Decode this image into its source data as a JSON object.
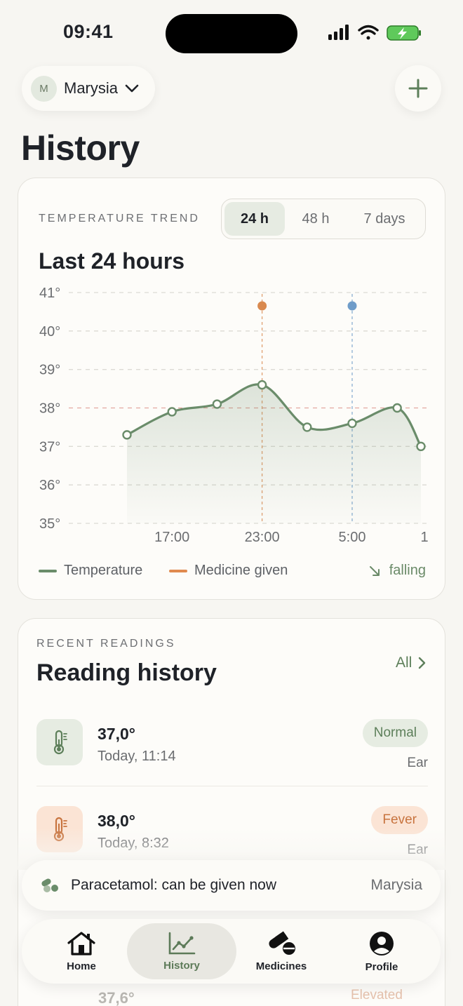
{
  "status_bar": {
    "time": "09:41"
  },
  "header": {
    "profile_initial": "M",
    "profile_name": "Marysia",
    "title": "History"
  },
  "trend": {
    "eyebrow": "TEMPERATURE TREND",
    "ranges": [
      "24 h",
      "48 h",
      "7 days"
    ],
    "selected_range": "24 h",
    "title": "Last 24 hours",
    "legend_temperature": "Temperature",
    "legend_medicine": "Medicine given",
    "trend_label": "falling"
  },
  "chart_data": {
    "type": "line",
    "title": "Last 24 hours",
    "y_ticks": [
      "41°",
      "40°",
      "39°",
      "38°",
      "37°",
      "36°",
      "35°"
    ],
    "ylim": [
      35,
      41
    ],
    "x_ticks": [
      "17:00",
      "23:00",
      "5:00",
      "1"
    ],
    "grid": true,
    "fever_threshold": 38,
    "series": [
      {
        "name": "Temperature",
        "points": [
          {
            "x": "14:00",
            "y": 37.3
          },
          {
            "x": "17:00",
            "y": 37.9
          },
          {
            "x": "20:00",
            "y": 38.1
          },
          {
            "x": "23:00",
            "y": 38.6
          },
          {
            "x": "2:00",
            "y": 37.5
          },
          {
            "x": "5:00",
            "y": 37.6
          },
          {
            "x": "8:00",
            "y": 38.0
          },
          {
            "x": "11:14",
            "y": 37.0
          }
        ]
      }
    ],
    "medicine_events": [
      {
        "x": "23:00",
        "color": "#d9894f"
      },
      {
        "x": "5:00",
        "color": "#6f9cc9"
      }
    ],
    "colors": {
      "line": "#6a8c6a",
      "fever_line": "#e3a7a0"
    }
  },
  "readings": {
    "eyebrow": "RECENT READINGS",
    "title": "Reading history",
    "all_label": "All",
    "items": [
      {
        "value": "37,0°",
        "time": "Today, 11:14",
        "status": "Normal",
        "method": "Ear"
      },
      {
        "value": "38,0°",
        "time": "Today, 8:32",
        "status": "Fever",
        "method": "Ear"
      }
    ],
    "peek_value": "37,6°",
    "peek_status": "Elevated"
  },
  "toast": {
    "text": "Paracetamol: can be given now",
    "who": "Marysia"
  },
  "tabs": [
    {
      "label": "Home",
      "icon": "home-icon"
    },
    {
      "label": "History",
      "icon": "chart-icon"
    },
    {
      "label": "Medicines",
      "icon": "pills-icon"
    },
    {
      "label": "Profile",
      "icon": "profile-icon"
    }
  ],
  "active_tab": "History",
  "colors": {
    "accent": "#5d7f5a",
    "normal_badge_bg": "#e6ece2",
    "fever_badge_bg": "#fbe4d5",
    "fever_text": "#c8743f"
  }
}
